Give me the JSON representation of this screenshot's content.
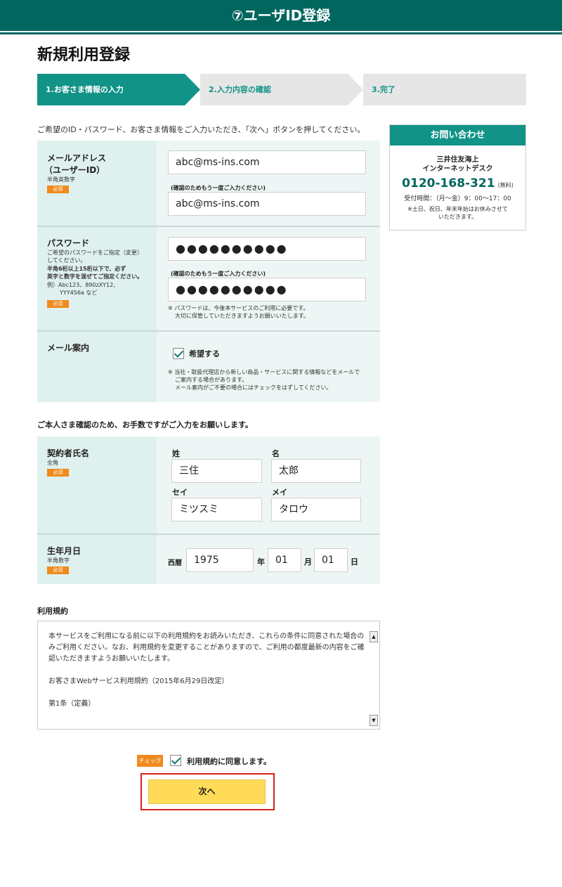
{
  "banner": {
    "title": "⑦ユーザID登録"
  },
  "page": {
    "title": "新規利用登録",
    "intro": "ご希望のID・パスワード、お客さま情報をご入力いただき、「次へ」ボタンを押してください。"
  },
  "steps": [
    {
      "label": "1.お客さま情報の入力",
      "active": true
    },
    {
      "label": "2.入力内容の確認",
      "active": false
    },
    {
      "label": "3.完了",
      "active": false
    }
  ],
  "contact": {
    "title": "お問い合わせ",
    "org_line1": "三井住友海上",
    "org_line2": "インターネットデスク",
    "phone": "0120-168-321",
    "phone_note": "(無料)",
    "hours": "受付時間：（月～金）9：00～17：00",
    "note_line1": "※土日、祝日、年末年始はお休みさせて",
    "note_line2": "いただきます。"
  },
  "required_badge": "必須",
  "email": {
    "label_line1": "メールアドレス",
    "label_line2": "（ユーザーID）",
    "sub": "半角英数字",
    "value": "abc@ms-ins.com",
    "confirm_caption": "(確認のためもう一度ご入力ください)",
    "confirm_value": "abc@ms-ins.com"
  },
  "password": {
    "label": "パスワード",
    "sub_line1": "ご希望のパスワードをご指定（変更）",
    "sub_line2": "してください。",
    "sub_line3": "半角6桁以上15桁以下で、必ず",
    "sub_line4": "英字と数字を混ぜてご指定ください。",
    "sub_line5": "例）Abc123、890zXY12、",
    "sub_line6": "YYY456a など",
    "value": "●●●●●●●●●●",
    "confirm_caption": "(確認のためもう一度ご入力ください)",
    "confirm_value": "●●●●●●●●●●",
    "note_line1": "※ パスワードは、今後本サービスのご利用に必要です。",
    "note_line2": "大切に保管していただきますようお願いいたします。"
  },
  "mail_info": {
    "label": "メール案内",
    "checkbox_label": "希望する",
    "checked": true,
    "note_line1": "※ 当社・取扱代理店から新しい商品・サービスに関する情報などをメールで",
    "note_line2": "ご案内する場合があります。",
    "note_line3": "メール案内がご不要の場合にはチェックをはずしてください。"
  },
  "identity_section_title": "ご本人さま確認のため、お手数ですがご入力をお願いします。",
  "name": {
    "label": "契約者氏名",
    "sub": "全角",
    "last_caption": "姓",
    "first_caption": "名",
    "last_value": "三住",
    "first_value": "太郎",
    "last_kana_caption": "セイ",
    "first_kana_caption": "メイ",
    "last_kana_value": "ミツスミ",
    "first_kana_value": "タロウ"
  },
  "birth": {
    "label": "生年月日",
    "sub": "半角数字",
    "era": "西暦",
    "year": "1975",
    "year_unit": "年",
    "month": "01",
    "month_unit": "月",
    "day": "01",
    "day_unit": "日"
  },
  "terms": {
    "title": "利用規約",
    "para1": "本サービスをご利用になる前に以下の利用規約をお読みいただき、これらの条件に同意された場合のみご利用ください。なお、利用規約を変更することがありますので、ご利用の都度最新の内容をご確認いただきますようお願いいたします。",
    "para2": "お客さまWebサービス利用規約（2015年6月29日改定）",
    "para3": "第1条（定義）",
    "scroll_up": "▲",
    "scroll_down": "▼"
  },
  "agree": {
    "badge": "チェック",
    "label": "利用規約に同意します。",
    "checked": true
  },
  "next_button": "次へ"
}
